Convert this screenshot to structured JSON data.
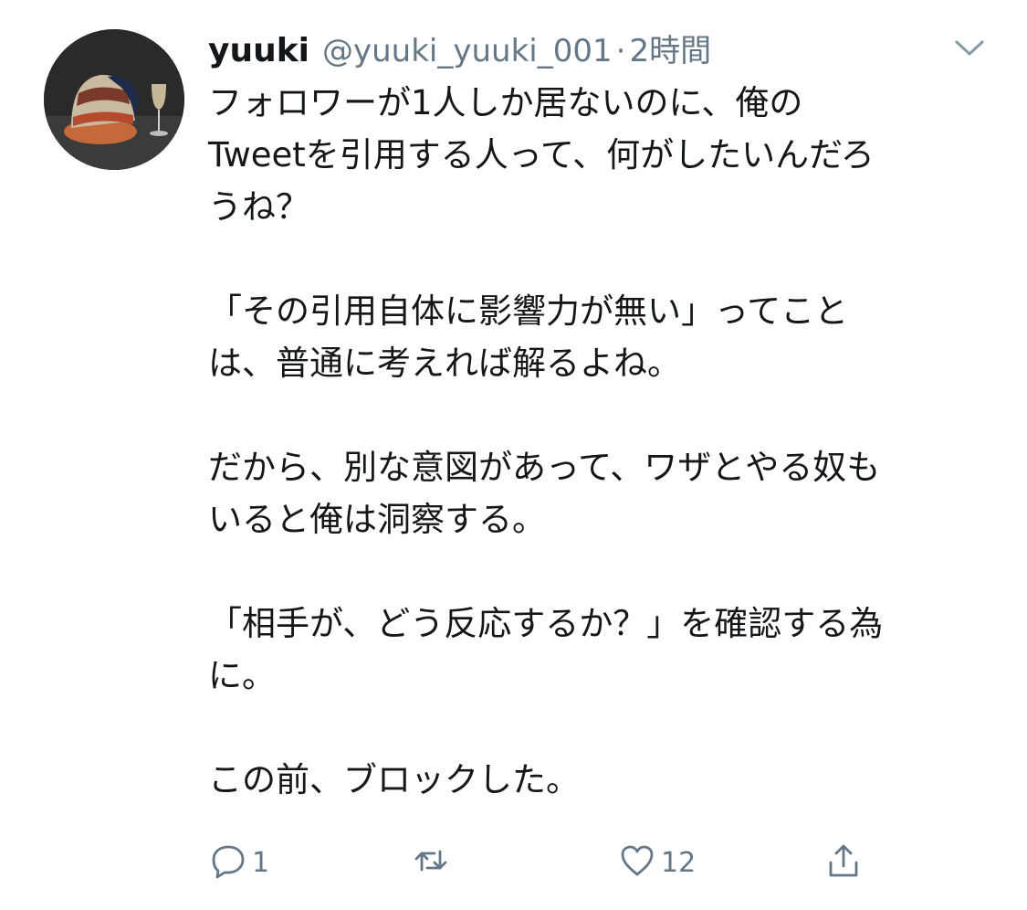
{
  "tweet": {
    "display_name": "yuuki",
    "handle": "@yuuki_yuuki_001",
    "separator": "·",
    "time": "2時間",
    "avatar_icon": "cap-and-glass-avatar",
    "caret_icon": "chevron-down-icon",
    "lines": [
      "フォロワーが1人しか居ないのに、俺の",
      "Tweetを引用する人って、何がしたいんだろ",
      "うね？",
      "",
      "「その引用自体に影響力が無い」ってこと",
      "は、普通に考えれば解るよね。",
      "",
      "だから、別な意図があって、ワザとやる奴も",
      "いると俺は洞察する。",
      "",
      "「相手が、どう反応するか？」を確認する為",
      "に。",
      "",
      "この前、ブロックした。"
    ]
  },
  "actions": {
    "reply": {
      "icon": "reply-icon",
      "count": "1"
    },
    "retweet": {
      "icon": "retweet-icon",
      "count": ""
    },
    "like": {
      "icon": "heart-icon",
      "count": "12"
    },
    "share": {
      "icon": "share-icon",
      "count": ""
    }
  },
  "colors": {
    "text": "#14171a",
    "secondary": "#657786",
    "background": "#ffffff"
  }
}
